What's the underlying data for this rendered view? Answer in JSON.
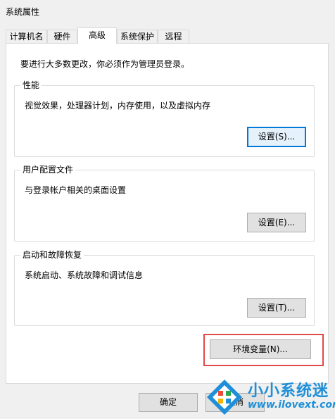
{
  "window": {
    "title": "系统属性"
  },
  "tabs": [
    {
      "label": "计算机名"
    },
    {
      "label": "硬件"
    },
    {
      "label": "高级",
      "active": true
    },
    {
      "label": "系统保护"
    },
    {
      "label": "远程"
    }
  ],
  "admin_note": "要进行大多数更改，你必须作为管理员登录。",
  "groups": {
    "performance": {
      "title": "性能",
      "description": "视觉效果，处理器计划，内存使用，以及虚拟内存",
      "button": "设置(S)..."
    },
    "user_profiles": {
      "title": "用户配置文件",
      "description": "与登录帐户相关的桌面设置",
      "button": "设置(E)..."
    },
    "startup_recovery": {
      "title": "启动和故障恢复",
      "description": "系统启动、系统故障和调试信息",
      "button": "设置(T)..."
    }
  },
  "env_button": "环境变量(N)...",
  "bottom": {
    "ok": "确定",
    "cancel": "取消"
  },
  "watermark": {
    "brand": "小小系统迷",
    "url": "www.ilovext.com"
  },
  "colors": {
    "accent": "#0078d7",
    "highlight": "#e04a4a",
    "watermark": "#1e8fd8"
  }
}
